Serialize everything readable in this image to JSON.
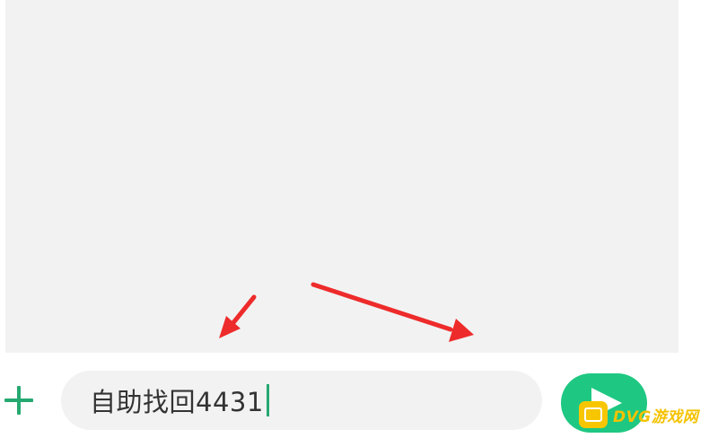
{
  "composer": {
    "input_value": "自助找回4431",
    "plus_icon": "plus-icon",
    "send_icon": "send-icon"
  },
  "watermark": {
    "text": "DVG游戏网"
  },
  "colors": {
    "accent": "#25a971",
    "send_button": "#1ec882",
    "annotation_arrow": "#ee2b2b",
    "chat_background": "#f2f2f2"
  }
}
